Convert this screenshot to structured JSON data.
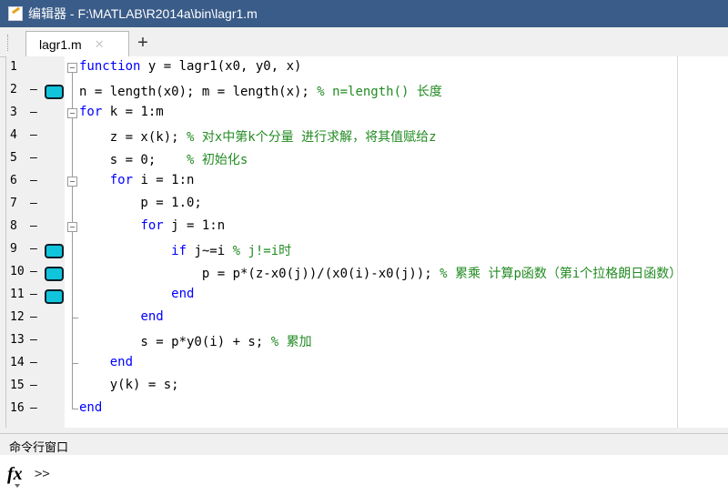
{
  "window": {
    "title": "编辑器 - F:\\MATLAB\\R2014a\\bin\\lagr1.m"
  },
  "tabs": [
    {
      "label": "lagr1.m",
      "close": "✕"
    }
  ],
  "add_tab": "+",
  "editor": {
    "lines": [
      {
        "num": "1",
        "dash": "",
        "bp": false,
        "fold": "box",
        "segments": [
          {
            "t": "function",
            "c": "kw"
          },
          {
            "t": " y = lagr1(x0, y0, x)",
            "c": ""
          }
        ]
      },
      {
        "num": "2",
        "dash": "—",
        "bp": true,
        "fold": "line",
        "segments": [
          {
            "t": "n = length(x0); m = length(x); ",
            "c": ""
          },
          {
            "t": "% n=length() 长度",
            "c": "cm"
          }
        ]
      },
      {
        "num": "3",
        "dash": "—",
        "bp": false,
        "fold": "box",
        "segments": [
          {
            "t": "for",
            "c": "kw"
          },
          {
            "t": " k = 1:m",
            "c": ""
          }
        ]
      },
      {
        "num": "4",
        "dash": "—",
        "bp": false,
        "fold": "line",
        "segments": [
          {
            "t": "    z = x(k); ",
            "c": ""
          },
          {
            "t": "% 对x中第k个分量 进行求解，将其值赋给z",
            "c": "cm"
          }
        ]
      },
      {
        "num": "5",
        "dash": "—",
        "bp": false,
        "fold": "line",
        "segments": [
          {
            "t": "    s = 0;    ",
            "c": ""
          },
          {
            "t": "% 初始化s",
            "c": "cm"
          }
        ]
      },
      {
        "num": "6",
        "dash": "—",
        "bp": false,
        "fold": "box",
        "segments": [
          {
            "t": "    ",
            "c": ""
          },
          {
            "t": "for",
            "c": "kw"
          },
          {
            "t": " i = 1:n",
            "c": ""
          }
        ]
      },
      {
        "num": "7",
        "dash": "—",
        "bp": false,
        "fold": "line",
        "segments": [
          {
            "t": "        p = 1.0;",
            "c": ""
          }
        ]
      },
      {
        "num": "8",
        "dash": "—",
        "bp": false,
        "fold": "box",
        "segments": [
          {
            "t": "        ",
            "c": ""
          },
          {
            "t": "for",
            "c": "kw"
          },
          {
            "t": " j = 1:n",
            "c": ""
          }
        ]
      },
      {
        "num": "9",
        "dash": "—",
        "bp": true,
        "fold": "line",
        "segments": [
          {
            "t": "            ",
            "c": ""
          },
          {
            "t": "if",
            "c": "kw"
          },
          {
            "t": " j~=i ",
            "c": ""
          },
          {
            "t": "% j!=i时",
            "c": "cm"
          }
        ]
      },
      {
        "num": "10",
        "dash": "—",
        "bp": true,
        "fold": "line",
        "segments": [
          {
            "t": "                p = p*(z-x0(j))/(x0(i)-x0(j)); ",
            "c": ""
          },
          {
            "t": "% 累乘 计算p函数（第i个拉格朗日函数）",
            "c": "cm"
          }
        ]
      },
      {
        "num": "11",
        "dash": "—",
        "bp": true,
        "fold": "line",
        "segments": [
          {
            "t": "            ",
            "c": ""
          },
          {
            "t": "end",
            "c": "kw"
          }
        ]
      },
      {
        "num": "12",
        "dash": "—",
        "bp": false,
        "fold": "tick",
        "segments": [
          {
            "t": "        ",
            "c": ""
          },
          {
            "t": "end",
            "c": "kw"
          }
        ]
      },
      {
        "num": "13",
        "dash": "—",
        "bp": false,
        "fold": "line",
        "segments": [
          {
            "t": "        s = p*y0(i) + s; ",
            "c": ""
          },
          {
            "t": "% 累加",
            "c": "cm"
          }
        ]
      },
      {
        "num": "14",
        "dash": "—",
        "bp": false,
        "fold": "tick",
        "segments": [
          {
            "t": "    ",
            "c": ""
          },
          {
            "t": "end",
            "c": "kw"
          }
        ]
      },
      {
        "num": "15",
        "dash": "—",
        "bp": false,
        "fold": "line",
        "segments": [
          {
            "t": "    y(k) = s;",
            "c": ""
          }
        ]
      },
      {
        "num": "16",
        "dash": "—",
        "bp": false,
        "fold": "tick",
        "segments": [
          {
            "t": "end",
            "c": "kw"
          }
        ]
      }
    ]
  },
  "command_window": {
    "title": "命令行窗口",
    "fx": "fx",
    "prompt": ">>"
  },
  "colors": {
    "keyword": "#0000ff",
    "comment": "#228b22",
    "breakpoint": "#10c4dc",
    "titlebar": "#3a5c89"
  }
}
